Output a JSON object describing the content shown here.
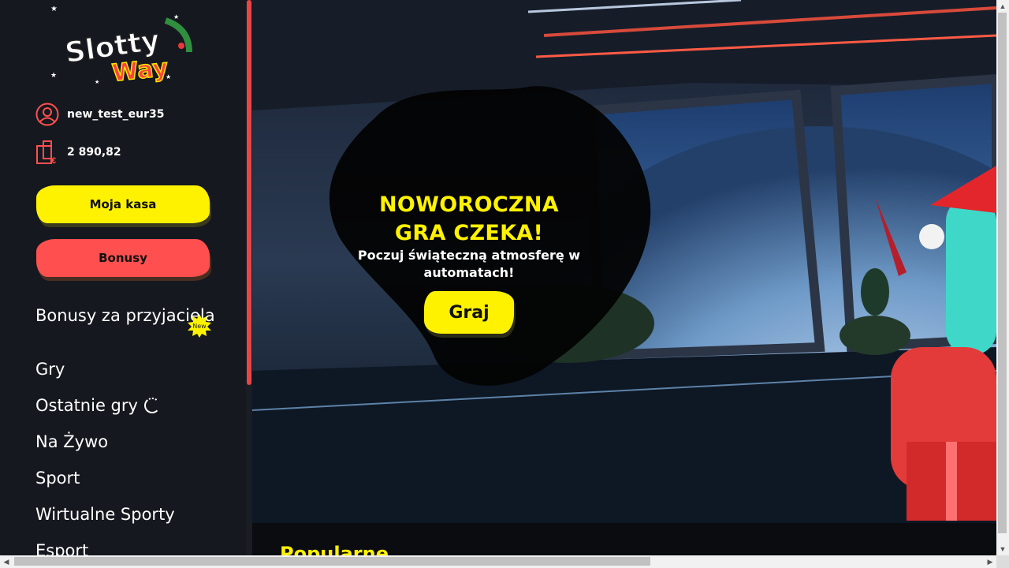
{
  "brand": {
    "logo_line1": "Slotty",
    "logo_line2": "Way"
  },
  "user": {
    "username": "new_test_eur35",
    "balance": "2 890,82",
    "currency_symbol": "€"
  },
  "sidebar": {
    "cash_button": "Moja kasa",
    "bonus_button": "Bonusy",
    "menu": [
      {
        "label": "Bonusy za przyjaciela",
        "badge": "New"
      },
      {
        "label": "Gry"
      },
      {
        "label": "Ostatnie gry"
      },
      {
        "label": "Na Żywo"
      },
      {
        "label": "Sport"
      },
      {
        "label": "Wirtualne Sporty"
      },
      {
        "label": "Esport"
      }
    ]
  },
  "hero": {
    "title": "NOWOROCZNA GRA CZEKA!",
    "subtitle": "Poczuj świąteczną atmosferę w automatach!",
    "cta": "Graj"
  },
  "sections": {
    "popular": "Popularne"
  },
  "colors": {
    "accent_yellow": "#fff200",
    "accent_red": "#ff4f4f",
    "sidebar_bg": "#16181f"
  }
}
